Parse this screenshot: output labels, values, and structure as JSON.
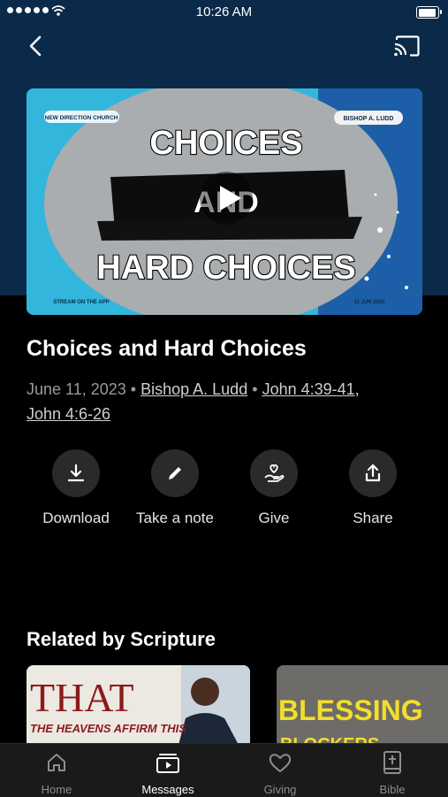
{
  "status_bar": {
    "time": "10:26 AM"
  },
  "header": {
    "back_icon": "chevron-left-icon",
    "cast_icon": "cast-icon"
  },
  "video": {
    "thumb": {
      "church": "NEW DIRECTION CHURCH",
      "speaker": "BISHOP A. LUDD",
      "line1": "CHOICES",
      "line2": "AND",
      "line3": "HARD CHOICES",
      "stream": "STREAM ON THE APP",
      "date": "11 JUN 2023"
    },
    "play_icon": "play-icon"
  },
  "message": {
    "title": "Choices and Hard Choices",
    "date": "June 11, 2023",
    "sep": "•",
    "speaker": "Bishop A. Ludd",
    "scripture1": "John 4:39-41,",
    "scripture2": "John 4:6-26"
  },
  "actions": [
    {
      "label": "Download",
      "icon": "download-icon"
    },
    {
      "label": "Take a note",
      "icon": "pencil-icon"
    },
    {
      "label": "Give",
      "icon": "give-hand-heart-icon"
    },
    {
      "label": "Share",
      "icon": "share-icon"
    }
  ],
  "related": {
    "title": "Related by Scripture",
    "cards": [
      {
        "headline": "THAT",
        "subhead": "THE HEAVENS AFFIRM THIS"
      },
      {
        "headline": "BLESSING",
        "subhead": "BLOCKERS"
      }
    ]
  },
  "tabs": [
    {
      "label": "Home",
      "icon": "home-icon",
      "active": false
    },
    {
      "label": "Messages",
      "icon": "messages-icon",
      "active": true
    },
    {
      "label": "Giving",
      "icon": "heart-icon",
      "active": false
    },
    {
      "label": "Bible",
      "icon": "bible-icon",
      "active": false
    }
  ]
}
